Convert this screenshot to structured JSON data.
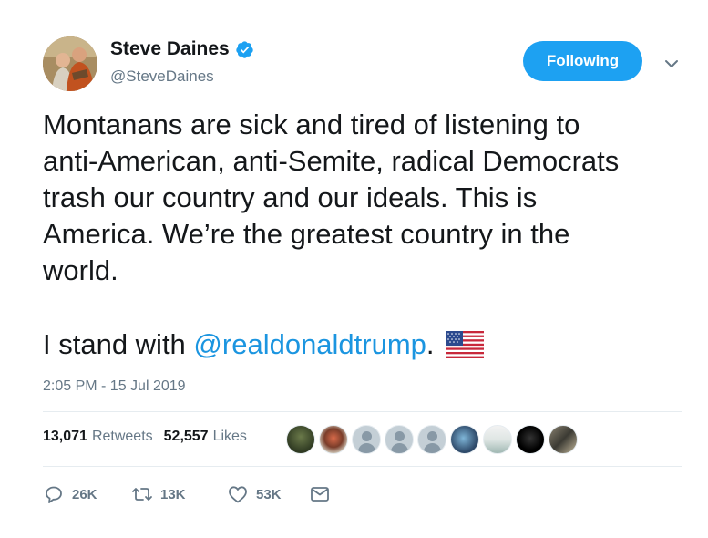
{
  "author": {
    "name": "Steve Daines",
    "handle": "@SteveDaines"
  },
  "header": {
    "follow_label": "Following"
  },
  "tweet": {
    "text_main": "Montanans are sick and tired of listening to\nanti-American, anti-Semite, radical Democrats\ntrash our country and our ideals. This is\nAmerica. We’re the greatest country in the\nworld.",
    "text_prefix": "I stand with ",
    "mention": "@realdonaldtrump",
    "text_suffix": ".",
    "timestamp": "2:05 PM - 15 Jul 2019"
  },
  "stats": {
    "retweets_count": "13,071",
    "retweets_label": "Retweets",
    "likes_count": "52,557",
    "likes_label": "Likes"
  },
  "actions": {
    "replies": "26K",
    "retweets": "13K",
    "likes": "53K"
  },
  "colors": {
    "accent": "#1da1f2",
    "link": "#1b95e0",
    "muted": "#657786"
  }
}
